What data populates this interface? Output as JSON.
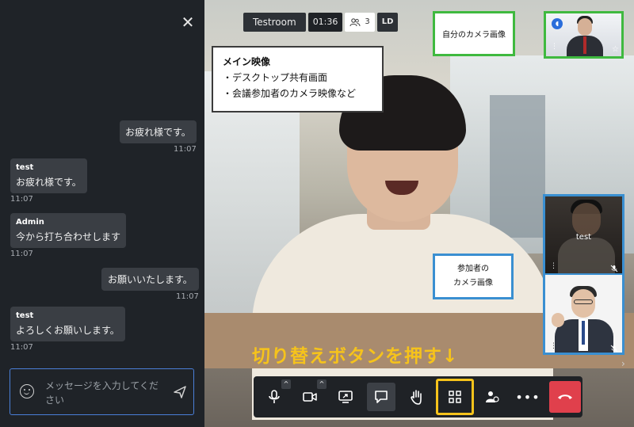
{
  "chat": {
    "messages": [
      {
        "type": "own",
        "text": "お疲れ様です。",
        "time": "11:07"
      },
      {
        "type": "other",
        "sender": "test",
        "text": "お疲れ様です。",
        "time": "11:07"
      },
      {
        "type": "other",
        "sender": "Admin",
        "text": "今から打ち合わせします",
        "time": "11:07"
      },
      {
        "type": "own",
        "text": "お願いいたします。",
        "time": "11:07"
      },
      {
        "type": "other",
        "sender": "test",
        "text": "よろしくお願いします。",
        "time": "11:07"
      }
    ],
    "input_placeholder": "メッセージを入力してください"
  },
  "meeting": {
    "room_name": "Testroom",
    "elapsed": "01:36",
    "participant_count": "3",
    "quality": "LD"
  },
  "annotations": {
    "main_title": "メイン映像",
    "main_line1": "・デスクトップ共有画面",
    "main_line2": "・会議参加者のカメラ映像など",
    "self_camera": "自分のカメラ画像",
    "participant_camera_line1": "参加者の",
    "participant_camera_line2": "カメラ画像",
    "switch_instruction": "切り替えボタンを押す↓"
  },
  "thumbnails": {
    "participant1_name": "test"
  },
  "colors": {
    "accent_yellow": "#f6c31b",
    "self_frame_green": "#3fb93f",
    "participant_frame_blue": "#3a8fd1",
    "hangup_red": "#e0404c"
  },
  "toolbar_icons": [
    "microphone-icon",
    "camera-icon",
    "screen-share-icon",
    "chat-icon",
    "raise-hand-icon",
    "tile-view-icon",
    "participants-icon",
    "more-icon",
    "hangup-icon"
  ]
}
